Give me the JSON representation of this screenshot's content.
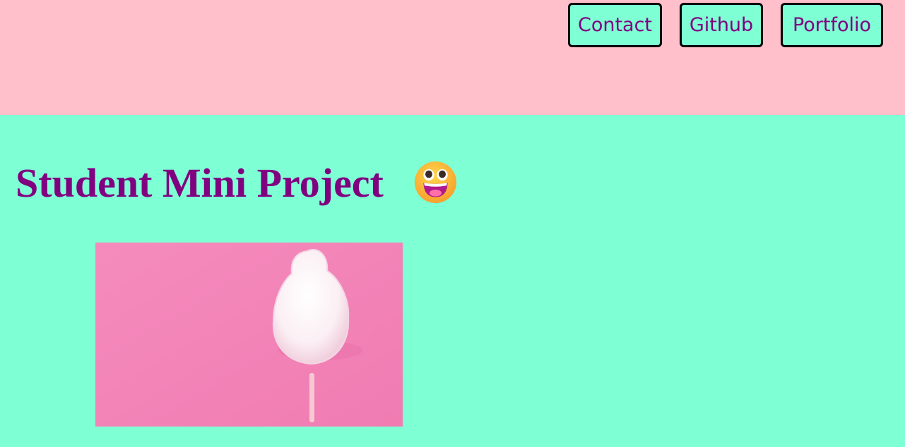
{
  "nav": {
    "contact_label": "Contact",
    "github_label": "Github",
    "portfolio_label": "Portfolio"
  },
  "main": {
    "title": "Student Mini Project",
    "emoji_icon": "grinning-face-with-big-eyes-icon",
    "image_subject": "cotton-candy-on-pink-background"
  },
  "colors": {
    "header_bg": "#ffc0cb",
    "page_bg": "#7fffd4",
    "text_purple": "#800080",
    "button_border": "#000000"
  }
}
